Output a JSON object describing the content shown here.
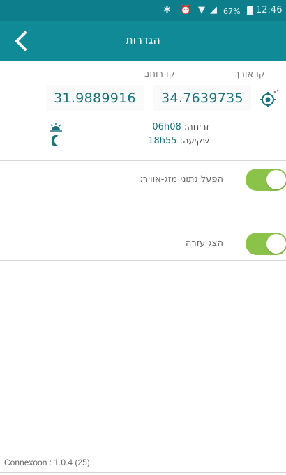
{
  "status_bar": {
    "bluetooth": "✱",
    "alarm": "⏰",
    "wifi": "▼",
    "signal": "◢",
    "battery_pct": "67%",
    "time": "12:46"
  },
  "header": {
    "title": "הגדרות",
    "back_icon": "chevron-left-icon"
  },
  "coordinates": {
    "longitude_label": "קו אורך",
    "latitude_label": "קו רוחב",
    "longitude_value": "34.7639735",
    "latitude_value": "31.9889916",
    "locate_icon": "gps-locate-icon"
  },
  "sun": {
    "sunrise_label": "זריחה:",
    "sunrise_time": "06h08",
    "sunset_label": "שקיעה:",
    "sunset_time": "18h55",
    "sunrise_icon": "sunrise-icon",
    "sunset_icon": "moon-icon"
  },
  "settings": {
    "weather_label": "הפעל נתוני מזג-אוויר:",
    "weather_enabled": true,
    "help_label": "הצג עזרה",
    "help_enabled": true
  },
  "footer": {
    "version": "Connexoon : 1.0.4 (25)"
  },
  "colors": {
    "header": "#0f8a96",
    "status_bar": "#0d7f8c",
    "accent_text": "#19727c",
    "toggle_on": "#8bc34a"
  }
}
